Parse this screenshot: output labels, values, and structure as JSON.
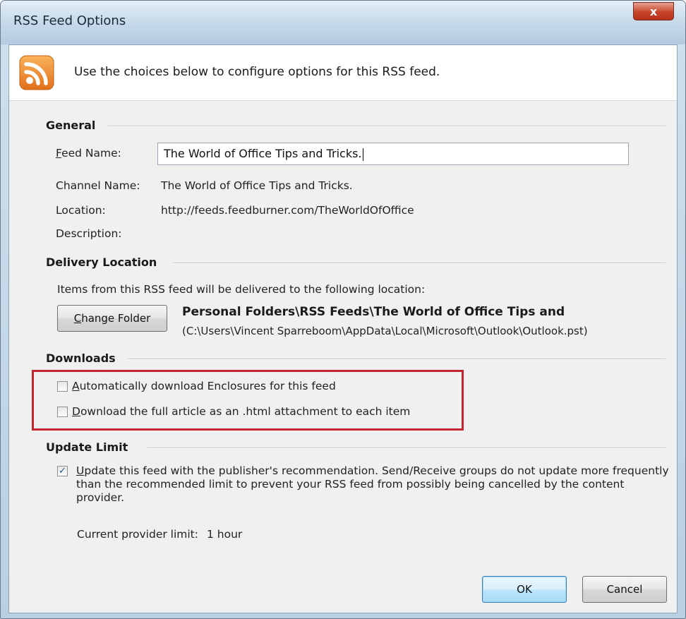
{
  "window": {
    "title": "RSS Feed Options",
    "close_glyph": "x"
  },
  "header": {
    "icon": "rss-icon",
    "text": "Use the choices below to configure options for this RSS feed."
  },
  "general": {
    "heading": "General",
    "feed_name_label": "Feed Name:",
    "feed_name_value": "The World of Office Tips and Tricks.",
    "channel_name_label": "Channel Name:",
    "channel_name_value": "The World of Office Tips and Tricks.",
    "location_label": "Location:",
    "location_value": "http://feeds.feedburner.com/TheWorldOfOffice",
    "description_label": "Description:"
  },
  "delivery": {
    "heading": "Delivery Location",
    "info": "Items from this RSS feed will be delivered to the following location:",
    "change_folder_label": "Change Folder",
    "folder_path": "Personal Folders\\RSS Feeds\\The World of Office Tips and",
    "file_path": "(C:\\Users\\Vincent Sparreboom\\AppData\\Local\\Microsoft\\Outlook\\Outlook.pst)"
  },
  "downloads": {
    "heading": "Downloads",
    "enclosures_label": "Automatically download Enclosures for this feed",
    "enclosures_checked": false,
    "full_article_label": "Download the full article as an .html attachment to each item",
    "full_article_checked": false
  },
  "update_limit": {
    "heading": "Update Limit",
    "recommendation_label": "Update this feed with the publisher's recommendation. Send/Receive groups do not update more frequently than the recommended limit to prevent your RSS feed from possibly being cancelled by the content provider.",
    "recommendation_checked": true,
    "check_glyph": "✓",
    "provider_limit_label": "Current provider limit:",
    "provider_limit_value": "1 hour"
  },
  "buttons": {
    "ok_label": "OK",
    "cancel_label": "Cancel"
  },
  "colors": {
    "highlight": "#c2252e",
    "rss_orange": "#f28a1e",
    "titlebar": "#c8dbeb"
  }
}
